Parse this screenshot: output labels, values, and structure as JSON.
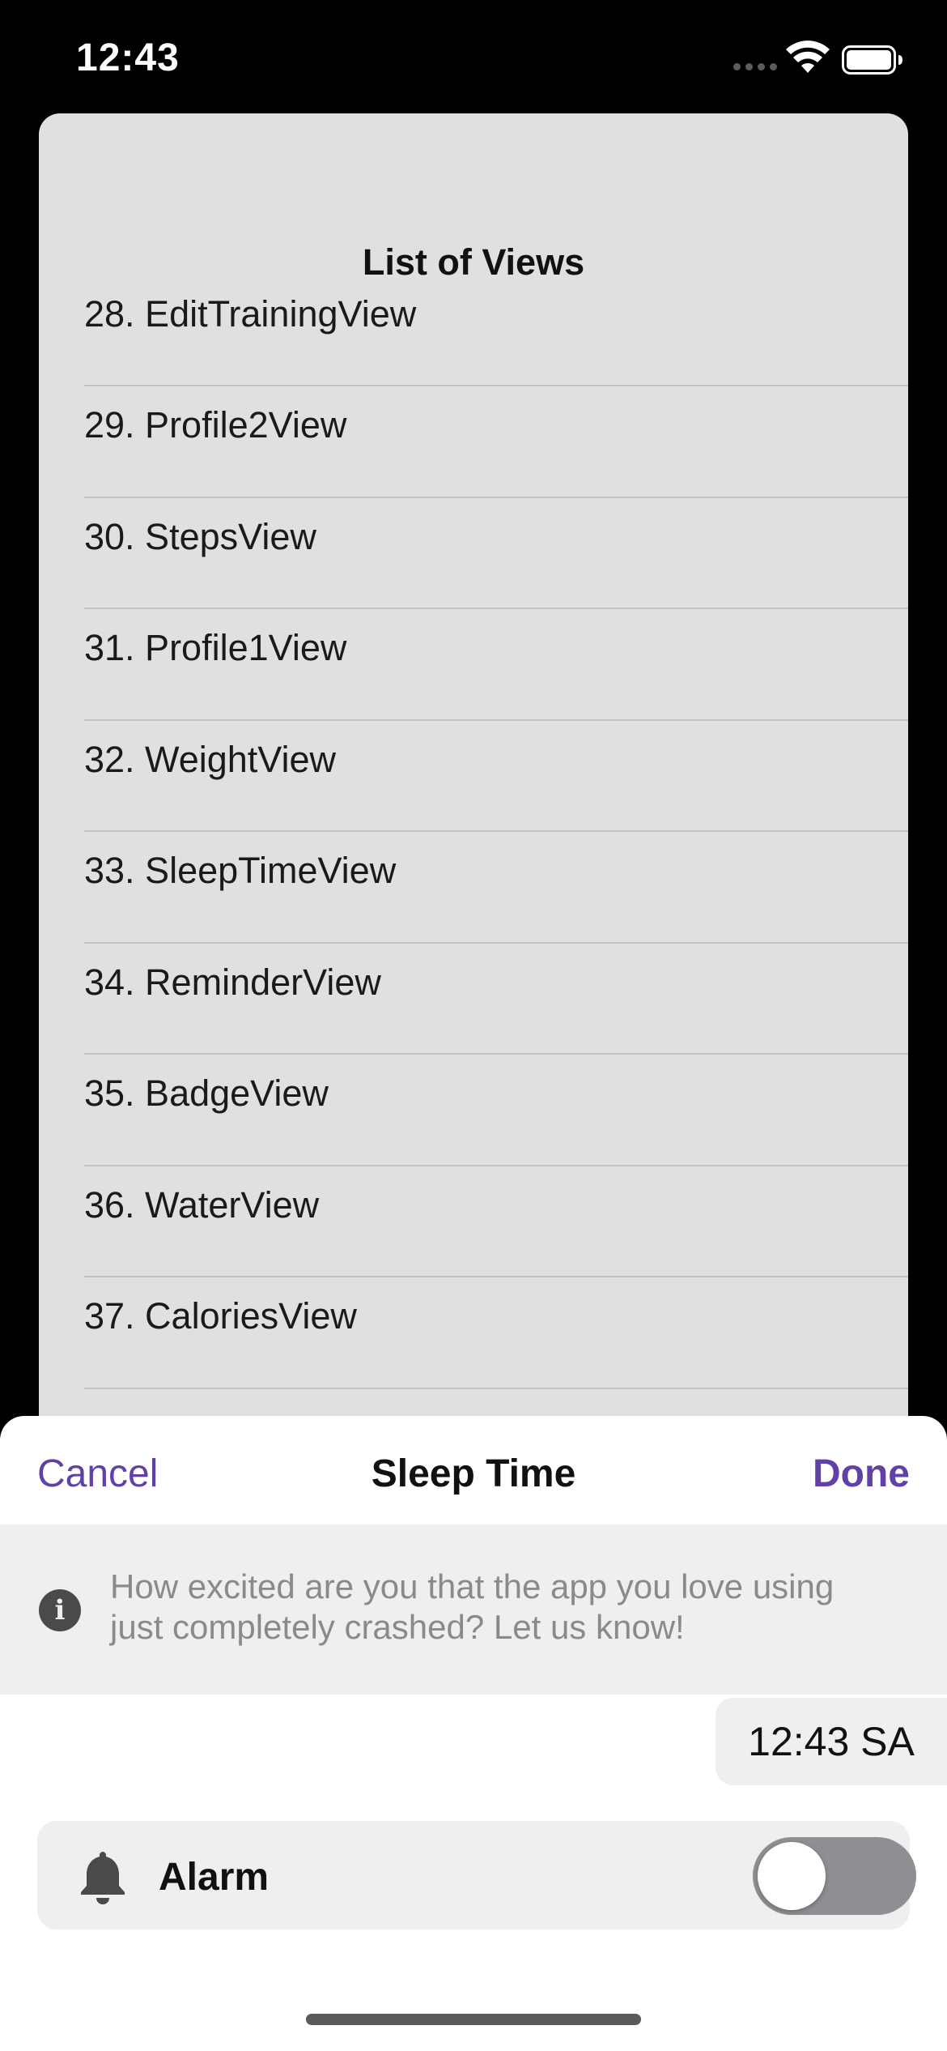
{
  "status_bar": {
    "time": "12:43",
    "icons": [
      "signal-dots-icon",
      "wifi-icon",
      "battery-icon"
    ]
  },
  "background_sheet": {
    "title": "List of Views",
    "items": [
      "28. EditTrainingView",
      "29. Profile2View",
      "30. StepsView",
      "31. Profile1View",
      "32. WeightView",
      "33. SleepTimeView",
      "34. ReminderView",
      "35. BadgeView",
      "36. WaterView",
      "37. CaloriesView"
    ]
  },
  "modal": {
    "cancel_label": "Cancel",
    "title": "Sleep Time",
    "done_label": "Done",
    "info_icon": "info-circle-icon",
    "info_text": "How excited are you that the app you love using just completely crashed? Let us know!",
    "time_value": "12:43 SA",
    "alarm": {
      "icon": "bell-icon",
      "label": "Alarm",
      "enabled": false
    }
  },
  "colors": {
    "accent": "#6141a8",
    "sheet_background": "#e0e0e0",
    "banner_background": "#efefef",
    "toggle_off": "#8e8e93"
  }
}
